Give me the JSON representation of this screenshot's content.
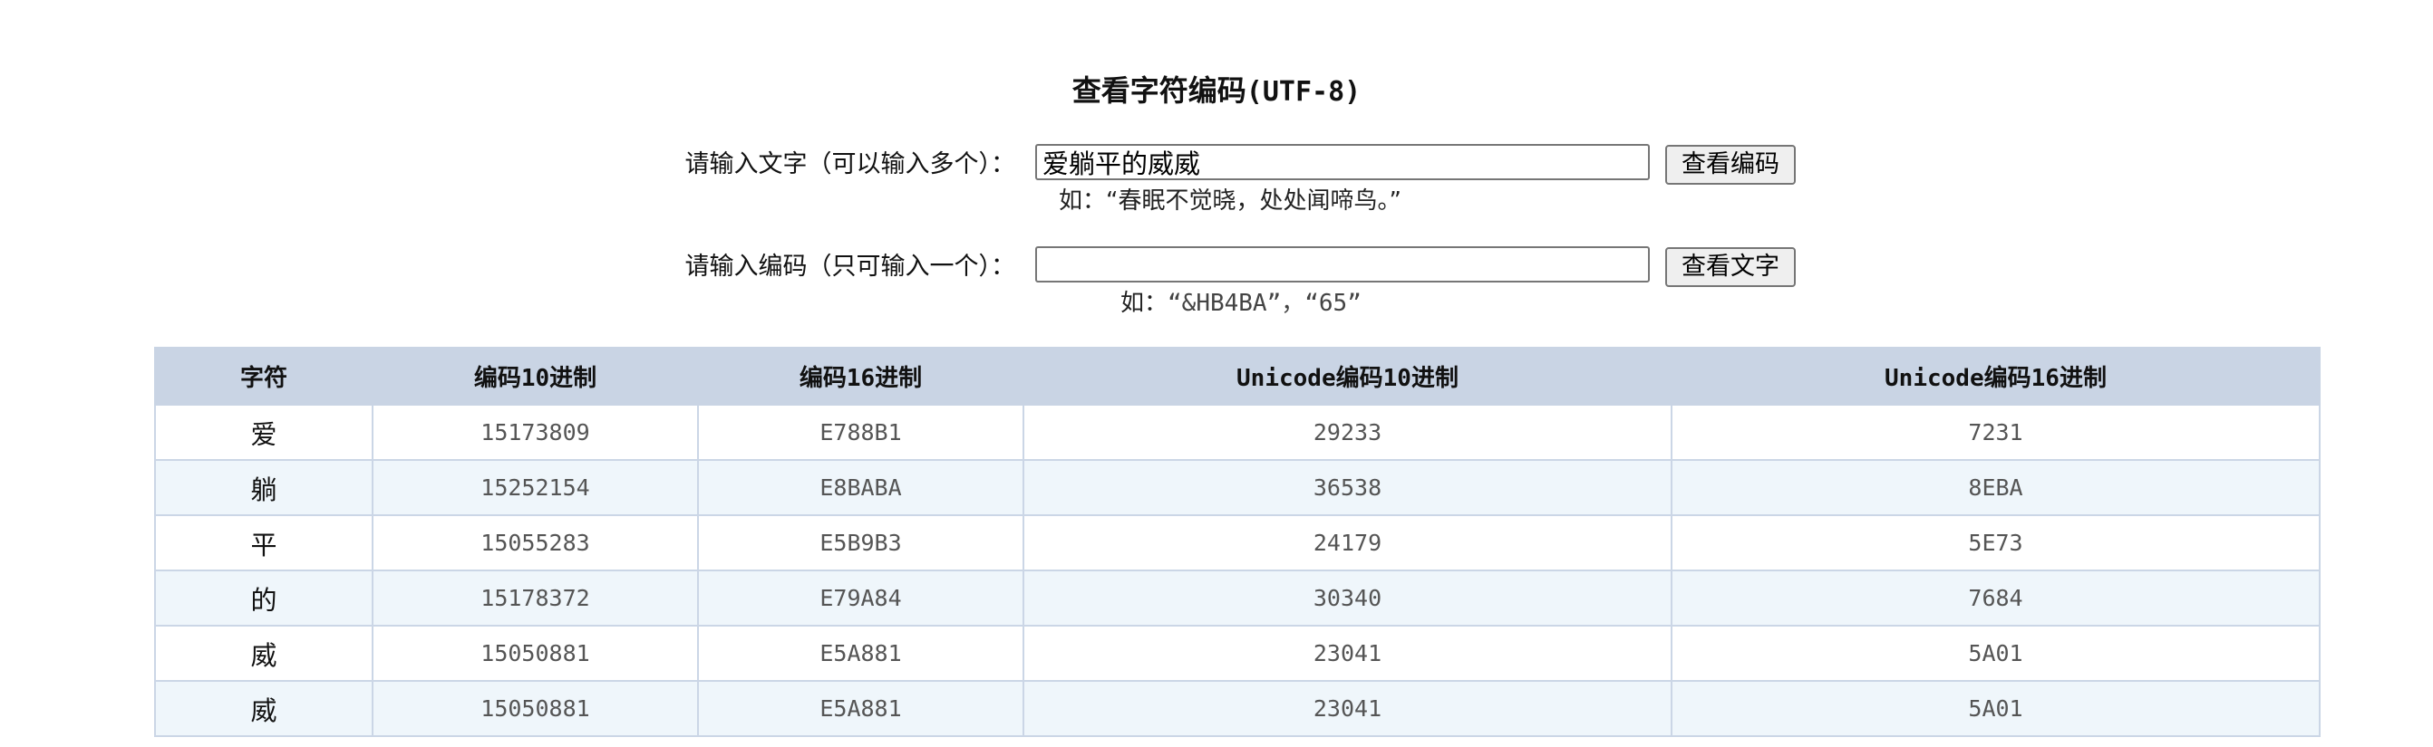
{
  "title": {
    "main": "查看字符编码",
    "suffix": "(UTF-8)"
  },
  "text_row": {
    "label": "请输入文字（可以输入多个）：",
    "value": "爱躺平的威威",
    "button": "查看编码",
    "hint_prefix": "如：",
    "hint_example": "“春眠不觉晓，处处闻啼鸟。”"
  },
  "code_row": {
    "label": "请输入编码（只可输入一个）：",
    "value": "",
    "button": "查看文字",
    "hint_prefix": "如：",
    "hint_example": "“&HB4BA”，“65”"
  },
  "table": {
    "headers": [
      {
        "cjk": "字符",
        "mono": ""
      },
      {
        "cjk": "编码",
        "mono": "10",
        "cjk2": "进制",
        "order": "cjk-mono"
      },
      {
        "cjk": "编码",
        "mono": "16",
        "cjk2": "进制",
        "order": "cjk-mono"
      },
      {
        "pre": "Unicode",
        "cjk": "编码",
        "mono": "10",
        "cjk2": "进制"
      },
      {
        "pre": "Unicode",
        "cjk": "编码",
        "mono": "16",
        "cjk2": "进制"
      }
    ],
    "rows": [
      [
        "爱",
        "15173809",
        "E788B1",
        "29233",
        "7231"
      ],
      [
        "躺",
        "15252154",
        "E8BABA",
        "36538",
        "8EBA"
      ],
      [
        "平",
        "15055283",
        "E5B9B3",
        "24179",
        "5E73"
      ],
      [
        "的",
        "15178372",
        "E79A84",
        "30340",
        "7684"
      ],
      [
        "威",
        "15050881",
        "E5A881",
        "23041",
        "5A01"
      ],
      [
        "威",
        "15050881",
        "E5A881",
        "23041",
        "5A01"
      ]
    ]
  }
}
